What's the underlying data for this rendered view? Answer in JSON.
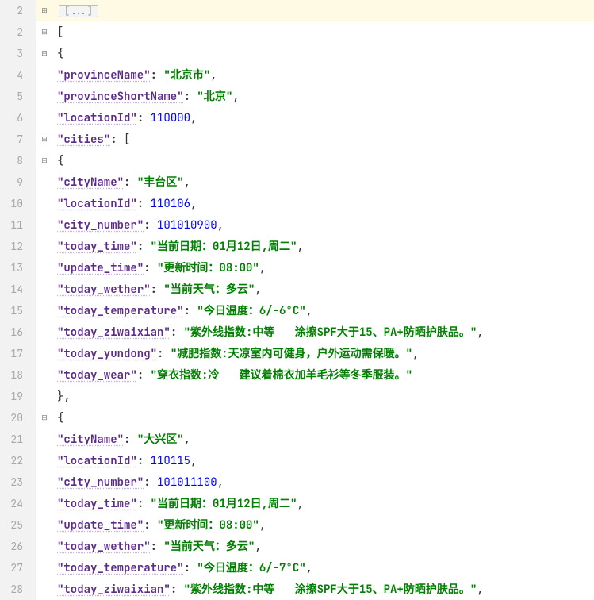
{
  "fold_label": "[...]",
  "lines": [
    {
      "num": "2",
      "current": true,
      "fold": "box",
      "indent": 5,
      "parts": [
        {
          "t": "foldbox",
          "v": "[...]"
        }
      ]
    },
    {
      "num": "2",
      "fold": "minus",
      "indent": 5,
      "parts": [
        {
          "t": "brace",
          "v": "["
        }
      ]
    },
    {
      "num": "3",
      "fold": "minus",
      "indent": 7,
      "parts": [
        {
          "t": "brace",
          "v": "{"
        }
      ]
    },
    {
      "num": "4",
      "indent": 9,
      "parts": [
        {
          "t": "key",
          "v": "\"provinceName\""
        },
        {
          "t": "colon",
          "v": ": "
        },
        {
          "t": "str",
          "v": "\"北京市\""
        },
        {
          "t": "punct",
          "v": ","
        }
      ]
    },
    {
      "num": "5",
      "indent": 9,
      "parts": [
        {
          "t": "key",
          "v": "\"provinceShortName\""
        },
        {
          "t": "colon",
          "v": ": "
        },
        {
          "t": "str",
          "v": "\"北京\""
        },
        {
          "t": "punct",
          "v": ","
        }
      ]
    },
    {
      "num": "6",
      "indent": 9,
      "parts": [
        {
          "t": "key",
          "v": "\"locationId\""
        },
        {
          "t": "colon",
          "v": ": "
        },
        {
          "t": "num",
          "v": "110000"
        },
        {
          "t": "punct",
          "v": ","
        }
      ]
    },
    {
      "num": "7",
      "fold": "minus",
      "indent": 9,
      "parts": [
        {
          "t": "key",
          "v": "\"cities\""
        },
        {
          "t": "colon",
          "v": ": "
        },
        {
          "t": "brace",
          "v": "["
        }
      ]
    },
    {
      "num": "8",
      "fold": "minus",
      "indent": 11,
      "parts": [
        {
          "t": "brace",
          "v": "{"
        }
      ]
    },
    {
      "num": "9",
      "indent": 13,
      "parts": [
        {
          "t": "key",
          "v": "\"cityName\""
        },
        {
          "t": "colon",
          "v": ": "
        },
        {
          "t": "str",
          "v": "\"丰台区\""
        },
        {
          "t": "punct",
          "v": ","
        }
      ]
    },
    {
      "num": "10",
      "indent": 13,
      "parts": [
        {
          "t": "key",
          "v": "\"locationId\""
        },
        {
          "t": "colon",
          "v": ": "
        },
        {
          "t": "num",
          "v": "110106"
        },
        {
          "t": "punct",
          "v": ","
        }
      ]
    },
    {
      "num": "11",
      "indent": 13,
      "parts": [
        {
          "t": "key",
          "v": "\"city_number\""
        },
        {
          "t": "colon",
          "v": ": "
        },
        {
          "t": "num",
          "v": "101010900"
        },
        {
          "t": "punct",
          "v": ","
        }
      ]
    },
    {
      "num": "12",
      "indent": 13,
      "parts": [
        {
          "t": "key",
          "v": "\"today_time\""
        },
        {
          "t": "colon",
          "v": ": "
        },
        {
          "t": "str",
          "v": "\"当前日期：01月12日,周二\""
        },
        {
          "t": "punct",
          "v": ","
        }
      ]
    },
    {
      "num": "13",
      "indent": 13,
      "parts": [
        {
          "t": "key",
          "v": "\"update_time\""
        },
        {
          "t": "colon",
          "v": ": "
        },
        {
          "t": "str",
          "v": "\"更新时间：08:00\""
        },
        {
          "t": "punct",
          "v": ","
        }
      ]
    },
    {
      "num": "14",
      "indent": 13,
      "parts": [
        {
          "t": "key",
          "v": "\"today_wether\""
        },
        {
          "t": "colon",
          "v": ": "
        },
        {
          "t": "str",
          "v": "\"当前天气：多云\""
        },
        {
          "t": "punct",
          "v": ","
        }
      ]
    },
    {
      "num": "15",
      "indent": 13,
      "parts": [
        {
          "t": "key",
          "v": "\"today_temperature\""
        },
        {
          "t": "colon",
          "v": ": "
        },
        {
          "t": "str",
          "v": "\"今日温度：6/-6°C\""
        },
        {
          "t": "punct",
          "v": ","
        }
      ]
    },
    {
      "num": "16",
      "indent": 13,
      "parts": [
        {
          "t": "key",
          "v": "\"today_ziwaixian\""
        },
        {
          "t": "colon",
          "v": ": "
        },
        {
          "t": "str",
          "v": "\"紫外线指数:中等   涂擦SPF大于15、PA+防晒护肤品。\""
        },
        {
          "t": "punct",
          "v": ","
        }
      ]
    },
    {
      "num": "17",
      "indent": 13,
      "parts": [
        {
          "t": "key",
          "v": "\"today_yundong\""
        },
        {
          "t": "colon",
          "v": ": "
        },
        {
          "t": "str",
          "v": "\"减肥指数:天凉室内可健身，户外运动需保暖。\""
        },
        {
          "t": "punct",
          "v": ","
        }
      ]
    },
    {
      "num": "18",
      "indent": 13,
      "parts": [
        {
          "t": "key",
          "v": "\"today_wear\""
        },
        {
          "t": "colon",
          "v": ": "
        },
        {
          "t": "str",
          "v": "\"穿衣指数:冷   建议着棉衣加羊毛衫等冬季服装。\""
        }
      ]
    },
    {
      "num": "19",
      "indent": 11,
      "parts": [
        {
          "t": "brace",
          "v": "},"
        }
      ]
    },
    {
      "num": "20",
      "fold": "minus",
      "indent": 11,
      "parts": [
        {
          "t": "brace",
          "v": "{"
        }
      ]
    },
    {
      "num": "21",
      "indent": 13,
      "parts": [
        {
          "t": "key",
          "v": "\"cityName\""
        },
        {
          "t": "colon",
          "v": ": "
        },
        {
          "t": "str",
          "v": "\"大兴区\""
        },
        {
          "t": "punct",
          "v": ","
        }
      ]
    },
    {
      "num": "22",
      "indent": 13,
      "parts": [
        {
          "t": "key",
          "v": "\"locationId\""
        },
        {
          "t": "colon",
          "v": ": "
        },
        {
          "t": "num",
          "v": "110115"
        },
        {
          "t": "punct",
          "v": ","
        }
      ]
    },
    {
      "num": "23",
      "indent": 13,
      "parts": [
        {
          "t": "key",
          "v": "\"city_number\""
        },
        {
          "t": "colon",
          "v": ": "
        },
        {
          "t": "num",
          "v": "101011100"
        },
        {
          "t": "punct",
          "v": ","
        }
      ]
    },
    {
      "num": "24",
      "indent": 13,
      "parts": [
        {
          "t": "key",
          "v": "\"today_time\""
        },
        {
          "t": "colon",
          "v": ": "
        },
        {
          "t": "str",
          "v": "\"当前日期：01月12日,周二\""
        },
        {
          "t": "punct",
          "v": ","
        }
      ]
    },
    {
      "num": "25",
      "indent": 13,
      "parts": [
        {
          "t": "key",
          "v": "\"update_time\""
        },
        {
          "t": "colon",
          "v": ": "
        },
        {
          "t": "str",
          "v": "\"更新时间：08:00\""
        },
        {
          "t": "punct",
          "v": ","
        }
      ]
    },
    {
      "num": "26",
      "indent": 13,
      "parts": [
        {
          "t": "key",
          "v": "\"today_wether\""
        },
        {
          "t": "colon",
          "v": ": "
        },
        {
          "t": "str",
          "v": "\"当前天气：多云\""
        },
        {
          "t": "punct",
          "v": ","
        }
      ]
    },
    {
      "num": "27",
      "indent": 13,
      "parts": [
        {
          "t": "key",
          "v": "\"today_temperature\""
        },
        {
          "t": "colon",
          "v": ": "
        },
        {
          "t": "str",
          "v": "\"今日温度：6/-7°C\""
        },
        {
          "t": "punct",
          "v": ","
        }
      ]
    },
    {
      "num": "28",
      "indent": 13,
      "parts": [
        {
          "t": "key",
          "v": "\"today_ziwaixian\""
        },
        {
          "t": "colon",
          "v": ": "
        },
        {
          "t": "str",
          "v": "\"紫外线指数:中等   涂擦SPF大于15、PA+防晒护肤品。\""
        },
        {
          "t": "punct",
          "v": ","
        }
      ]
    }
  ]
}
